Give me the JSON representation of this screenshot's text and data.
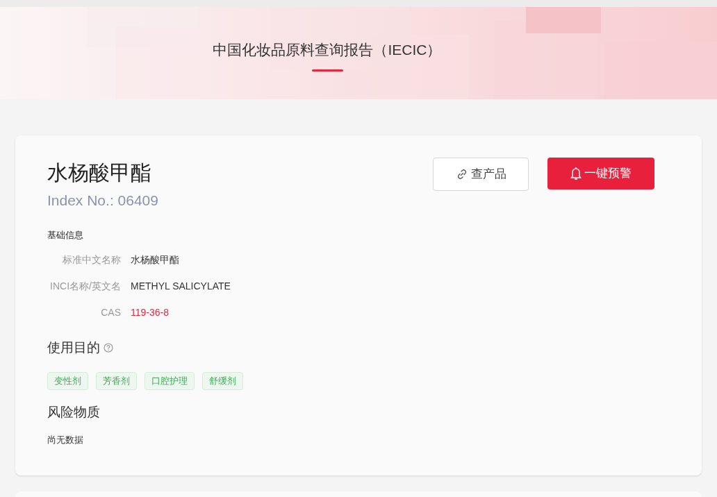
{
  "header": {
    "title": "中国化妆品原料查询报告（IECIC）"
  },
  "ingredient": {
    "name": "水杨酸甲酯",
    "index_no": "Index No.: 06409",
    "buttons": [
      {
        "kind": "outline",
        "label": "查产品"
      },
      {
        "kind": "primary",
        "label": "一键预警"
      }
    ],
    "basic_info": {
      "title": "基础信息",
      "fields": [
        {
          "label": "标准中文名称",
          "value": "水杨酸甲酯",
          "kind": "text"
        },
        {
          "label": "INCI名称/英文名",
          "value": "METHYL SALICYLATE",
          "kind": "text"
        },
        {
          "label": "CAS",
          "value": "119-36-8",
          "kind": "link"
        }
      ]
    },
    "purposes": {
      "title": "使用目的",
      "tags": [
        "变性剂",
        "芳香剂",
        "口腔护理",
        "舒缓剂"
      ]
    },
    "risk": {
      "title": "风险物质",
      "empty_text": "尚无数据"
    }
  }
}
